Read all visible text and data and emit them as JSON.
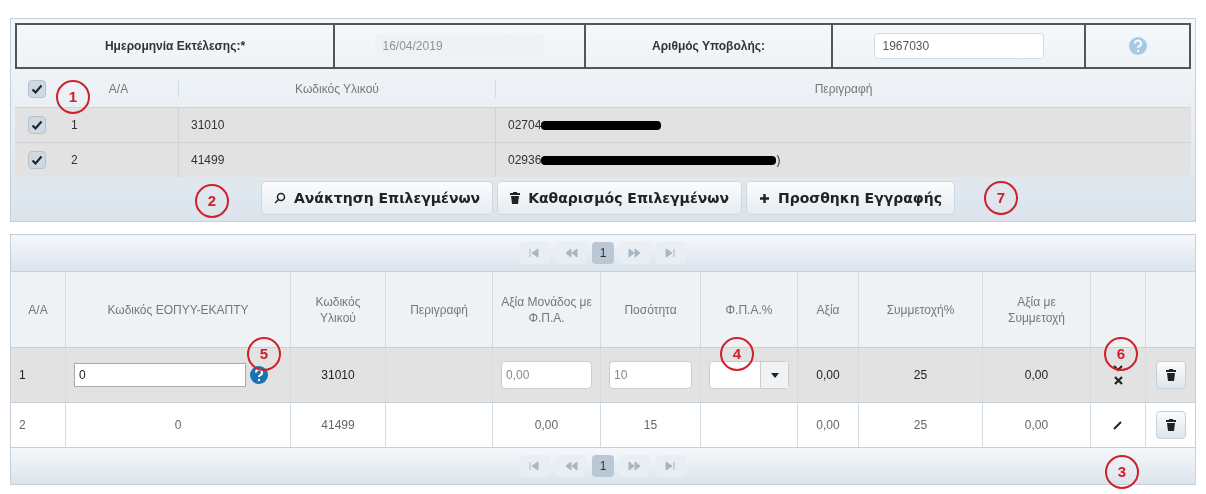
{
  "header_form": {
    "date_label": "Ημερομηνία Εκτέλεσης:*",
    "date_value": "16/04/2019",
    "date_disabled": true,
    "submission_label": "Αριθμός Υποβολής:",
    "submission_value": "1967030"
  },
  "selection_table": {
    "select_all_checked": true,
    "columns": [
      "A/A",
      "Κωδικός Υλικού",
      "Περιγραφή"
    ],
    "rows": [
      {
        "checked": true,
        "aa": "1",
        "code": "31010",
        "description": "02704",
        "redacted": true
      },
      {
        "checked": true,
        "aa": "2",
        "code": "41499",
        "description": "02936",
        "redacted": true,
        "description_end": ")"
      }
    ]
  },
  "actions": [
    {
      "kind": "retrieve",
      "label": "Ανάκτηση Επιλεγμένων"
    },
    {
      "kind": "clear",
      "label": "Καθαρισμός Επιλεγμένων"
    },
    {
      "kind": "add",
      "label": "Προσθηκη Εγγραφής"
    }
  ],
  "top_pager": {
    "pages": [
      {
        "label": "1",
        "selected": true
      }
    ]
  },
  "items_table": {
    "columns": [
      "A/A",
      "Κωδικός ΕΟΠΥΥ-ΕΚΑΠΤΥ",
      "Κωδικός Υλικού",
      "Περιγραφή",
      "Αξία Μονάδος με Φ.Π.Α.",
      "Ποσότητα",
      "Φ.Π.Α.%",
      "Αξία",
      "Συμμετοχή%",
      "Αξία με Συμμετοχή"
    ],
    "rows": [
      {
        "editing": true,
        "aa": "1",
        "eopyy_code": "0",
        "code": "31010",
        "unit_value": "0,00",
        "quantity": "10",
        "value": "0,00",
        "participation": "25",
        "value_with_participation": "0,00"
      },
      {
        "editing": false,
        "aa": "2",
        "eopyy_code": "0",
        "code": "41499",
        "unit_value": "0,00",
        "quantity": "15",
        "value": "0,00",
        "participation": "25",
        "value_with_participation": "0,00"
      }
    ]
  },
  "bottom_pager": {
    "pages": [
      {
        "label": "1",
        "selected": true
      }
    ]
  },
  "annotations": [
    {
      "label": "1"
    },
    {
      "label": "2"
    },
    {
      "label": "7"
    },
    {
      "label": "5"
    },
    {
      "label": "4"
    },
    {
      "label": "6"
    },
    {
      "label": "3"
    }
  ]
}
